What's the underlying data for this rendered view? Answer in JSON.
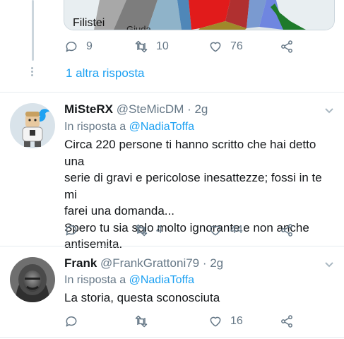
{
  "top_tweet": {
    "map_labels": [
      "Filistei",
      "Giuda"
    ],
    "actions": {
      "replies": "9",
      "retweets": "10",
      "likes": "76"
    },
    "more_replies": "1 altra risposta"
  },
  "tweets": [
    {
      "name": "MiSteRX",
      "handle": "@SteMicDM · 2g",
      "reply_prefix": "In risposta a",
      "reply_mention": "@NadiaToffa",
      "lines": [
        "Circa 220 persone ti hanno scritto che hai detto una",
        "serie di gravi e pericolose inesattezze; fossi in te mi",
        "farei una domanda...",
        "Spero tu sia solo molto ignorante e non anche",
        "antisemita."
      ],
      "actions": {
        "replies": "",
        "retweets": "4",
        "likes": "44"
      }
    },
    {
      "name": "Frank",
      "handle": "@FrankGrattoni79 · 2g",
      "reply_prefix": "In risposta a",
      "reply_mention": "@NadiaToffa",
      "lines": [
        "La storia, questa sconosciuta"
      ],
      "actions": {
        "replies": "",
        "retweets": "",
        "likes": "16"
      }
    }
  ],
  "colors": {
    "link": "#1da1f2",
    "muted": "#657786",
    "divider": "#e6ecf0"
  },
  "icons": [
    "reply-icon",
    "retweet-icon",
    "like-icon",
    "share-icon",
    "chevron-down-icon"
  ]
}
